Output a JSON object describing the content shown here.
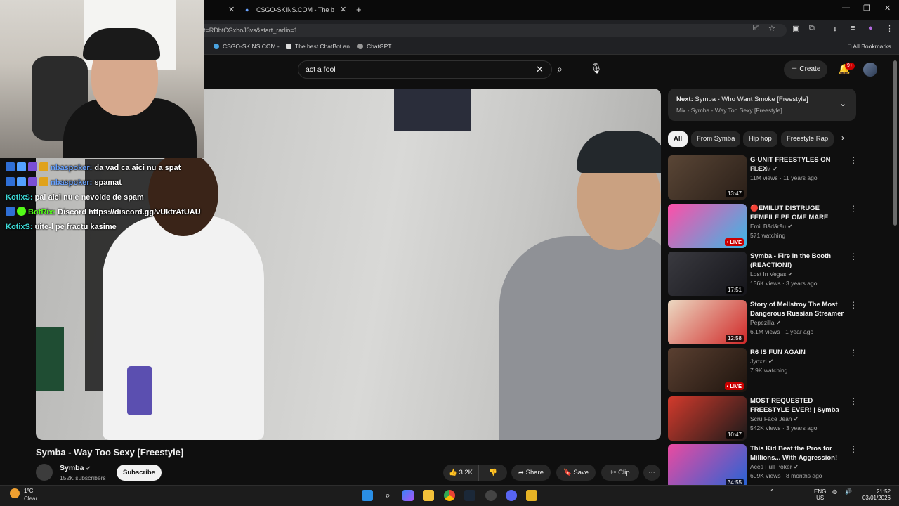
{
  "browser": {
    "tabs": [
      {
        "title": "",
        "close": "✕"
      },
      {
        "title": "CSGO-SKINS.COM - The best C",
        "close": "✕"
      }
    ],
    "new_tab": "+",
    "window_controls": {
      "minimize": "—",
      "maximize": "❐",
      "close": "✕"
    },
    "url": "t=RDbtCGxhoJ3vs&start_radio=1",
    "bookmarks": [
      "CSGO-SKINS.COM -...",
      "The best ChatBot an...",
      "ChatGPT"
    ],
    "all_bookmarks": "All Bookmarks"
  },
  "youtube": {
    "search_query": "act a fool",
    "create_label": "Create",
    "notifications_badge": "9+"
  },
  "chat": [
    {
      "user": "nbaspoker:",
      "message": "da vad ca aici nu a spat",
      "color": "#6aa3ff"
    },
    {
      "user": "nbaspoker:",
      "message": "spamat",
      "color": "#6aa3ff"
    },
    {
      "user": "KotixS:",
      "message": "pai aici nu e nevoide de spam",
      "color": "#3ddad7"
    },
    {
      "user": "BotRix:",
      "message": "Discord https://discord.gg/vUktrAtUAU",
      "color": "#53fc18"
    },
    {
      "user": "KotixS:",
      "message": "uite-l pe fractu kasime",
      "color": "#3ddad7"
    }
  ],
  "video": {
    "title": "Symba - Way Too Sexy [Freestyle]",
    "channel": "Symba",
    "subscribers": "152K subscribers",
    "subscribe_label": "Subscribe",
    "likes": "3.2K",
    "share_label": "Share",
    "save_label": "Save",
    "clip_label": "Clip"
  },
  "sidebar": {
    "next_label": "Next:",
    "next_title": "Symba - Who Want Smoke [Freestyle]",
    "next_sub": "Mix - Symba - Way Too Sexy [Freestyle]",
    "chips": [
      "All",
      "From Symba",
      "Hip hop",
      "Freestyle Rap"
    ],
    "recommendations": [
      {
        "title": "G-UNIT FREESTYLES ON FLEX",
        "channel": "HOT 97",
        "meta": "11M views · 11 years ago",
        "badge": "13:47",
        "live": false
      },
      {
        "title": "🔴EMILUT DISTRUGE FEMEILE PE OME MARE NEBUNIE / ROA...",
        "channel": "Emil Bădărău",
        "meta": "571 watching",
        "badge": "LIVE",
        "live": true
      },
      {
        "title": "Symba - Fire in the Booth (REACTION!)",
        "channel": "Lost In Vegas",
        "meta": "136K views · 3 years ago",
        "badge": "17:51",
        "live": false
      },
      {
        "title": "Story of Mellstroy The Most Dangerous Russian Streamer",
        "channel": "Pepezilla",
        "meta": "6.1M views · 1 year ago",
        "badge": "12:58",
        "live": false
      },
      {
        "title": "R6 IS FUN AGAIN",
        "channel": "Jynxzi",
        "meta": "7.9K watching",
        "badge": "LIVE",
        "live": true
      },
      {
        "title": "MOST REQUESTED FREESTYLE EVER! | Symba L.A. Leakers ...",
        "channel": "Scru Face Jean",
        "meta": "542K views · 3 years ago",
        "badge": "10:47",
        "live": false
      },
      {
        "title": "This Kid Beat the Pros for Millions... With Aggression!",
        "channel": "Aces Full Poker",
        "meta": "609K views · 8 months ago",
        "badge": "34:55",
        "live": false
      }
    ]
  },
  "taskbar": {
    "weather_temp": "1°C",
    "weather_cond": "Clear",
    "lang": "ENG",
    "region": "US",
    "time": "21:52",
    "date": "03/01/2026"
  }
}
